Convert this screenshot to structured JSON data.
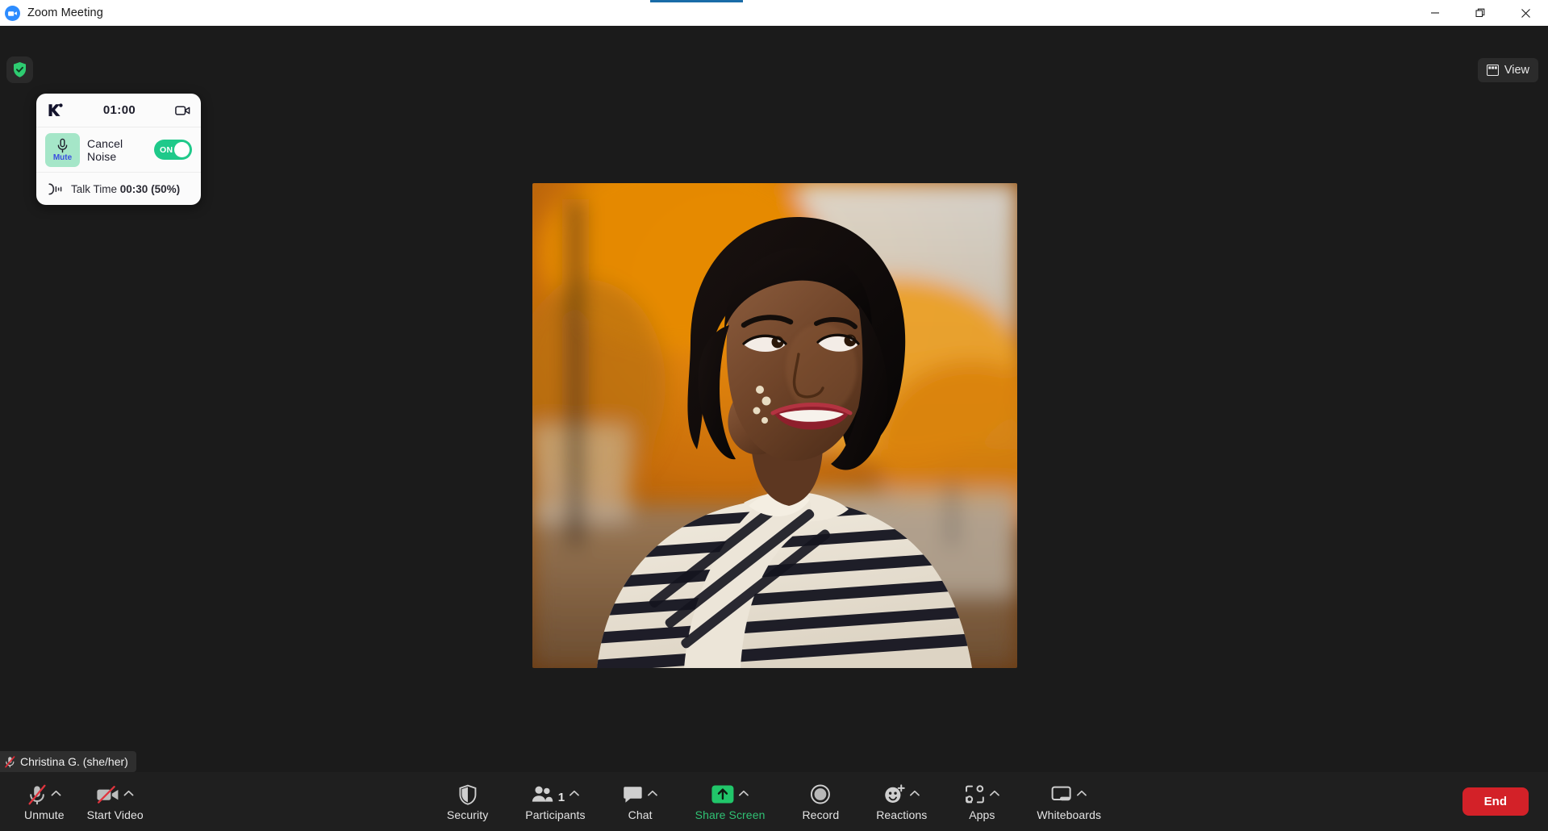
{
  "window": {
    "app_title": "Zoom Meeting",
    "logo_icon": "zoom-logo-icon",
    "minimize_icon": "minimize-icon",
    "maximize_icon": "maximize-restore-icon",
    "close_icon": "close-icon",
    "accent_color": "#1a6ca8"
  },
  "stage": {
    "encryption": {
      "icon": "shield-check-icon",
      "color": "#2ecc71"
    },
    "view": {
      "label": "View",
      "icon": "grid-view-icon"
    },
    "video_tile": {
      "participant": "Christina G.",
      "camera_on": true
    }
  },
  "krisp_widget": {
    "brand_icon": "krisp-logo-icon",
    "timer": "01:00",
    "camera_icon": "video-camera-icon",
    "mute": {
      "icon": "microphone-icon",
      "label": "Mute",
      "label_color": "#3b4de0",
      "background": "#a5e6c8"
    },
    "cancel_noise": {
      "label": "Cancel Noise",
      "toggle_state": "ON",
      "toggle_on": true,
      "toggle_color": "#1fc98a"
    },
    "talk_time": {
      "icon": "talk-time-icon",
      "label": "Talk Time",
      "value": "00:30",
      "percent": "(50%)"
    }
  },
  "self_view": {
    "name": "Christina G. (she/her)",
    "muted_icon": "mic-muted-red-icon"
  },
  "toolbar": {
    "audio": {
      "label": "Unmute",
      "icon": "mic-muted-icon",
      "caret_icon": "chevron-up-icon",
      "muted": true
    },
    "video": {
      "label": "Start Video",
      "icon": "video-off-icon",
      "caret_icon": "chevron-up-icon",
      "video_off": true
    },
    "center_items": [
      {
        "id": "security",
        "label": "Security",
        "icon": "shield-icon",
        "has_caret": false,
        "badge": null,
        "highlight": false
      },
      {
        "id": "participants",
        "label": "Participants",
        "icon": "people-icon",
        "has_caret": true,
        "badge": "1",
        "highlight": false
      },
      {
        "id": "chat",
        "label": "Chat",
        "icon": "chat-bubble-icon",
        "has_caret": true,
        "badge": null,
        "highlight": false
      },
      {
        "id": "share-screen",
        "label": "Share Screen",
        "icon": "share-screen-up-arrow-icon",
        "has_caret": true,
        "badge": null,
        "highlight": true
      },
      {
        "id": "record",
        "label": "Record",
        "icon": "record-circle-icon",
        "has_caret": false,
        "badge": null,
        "highlight": false
      },
      {
        "id": "reactions",
        "label": "Reactions",
        "icon": "smiley-plus-icon",
        "has_caret": true,
        "badge": null,
        "highlight": false
      },
      {
        "id": "apps",
        "label": "Apps",
        "icon": "apps-icon",
        "has_caret": true,
        "badge": null,
        "highlight": false
      },
      {
        "id": "whiteboards",
        "label": "Whiteboards",
        "icon": "whiteboard-icon",
        "has_caret": true,
        "badge": null,
        "highlight": false
      }
    ],
    "end": {
      "label": "End",
      "color": "#d32128"
    },
    "share_highlight_color": "#30c174"
  }
}
